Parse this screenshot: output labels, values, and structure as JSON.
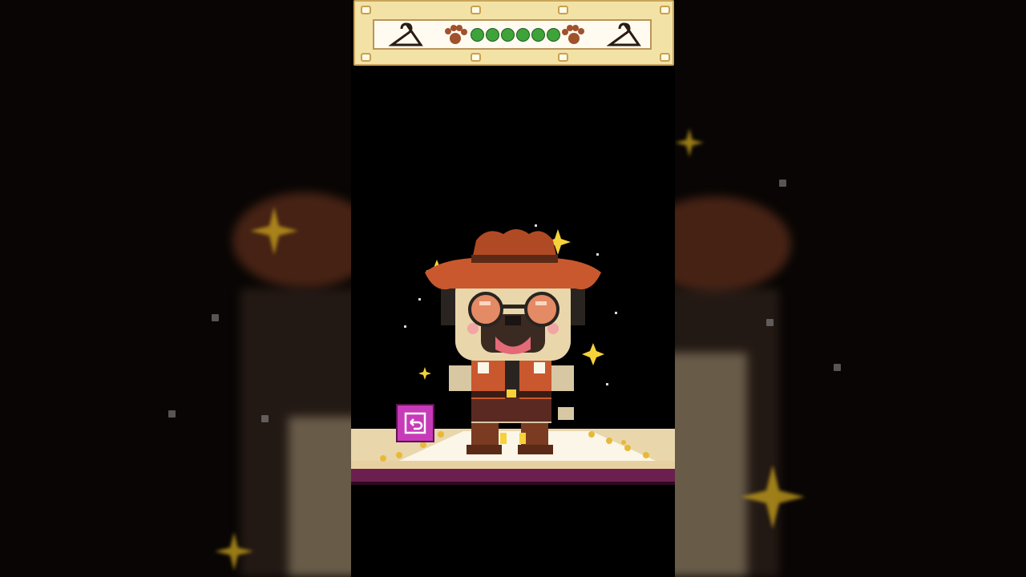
{
  "header": {
    "left_icon": "hanger-icon",
    "right_icon": "hanger-icon",
    "paw_icon": "paw-icon",
    "progress_dots": 6
  },
  "character": {
    "name_icon": "pug-cowboy",
    "outfit": [
      "cowboy-hat",
      "sunglasses",
      "vest",
      "boots"
    ]
  },
  "controls": {
    "undo_icon": "undo-icon"
  },
  "colors": {
    "background": "#000000",
    "header_bg": "#f3e2a6",
    "progress_green": "#3fa33b",
    "undo_button": "#c73bb8",
    "stage_trim": "#6b1f4f"
  }
}
